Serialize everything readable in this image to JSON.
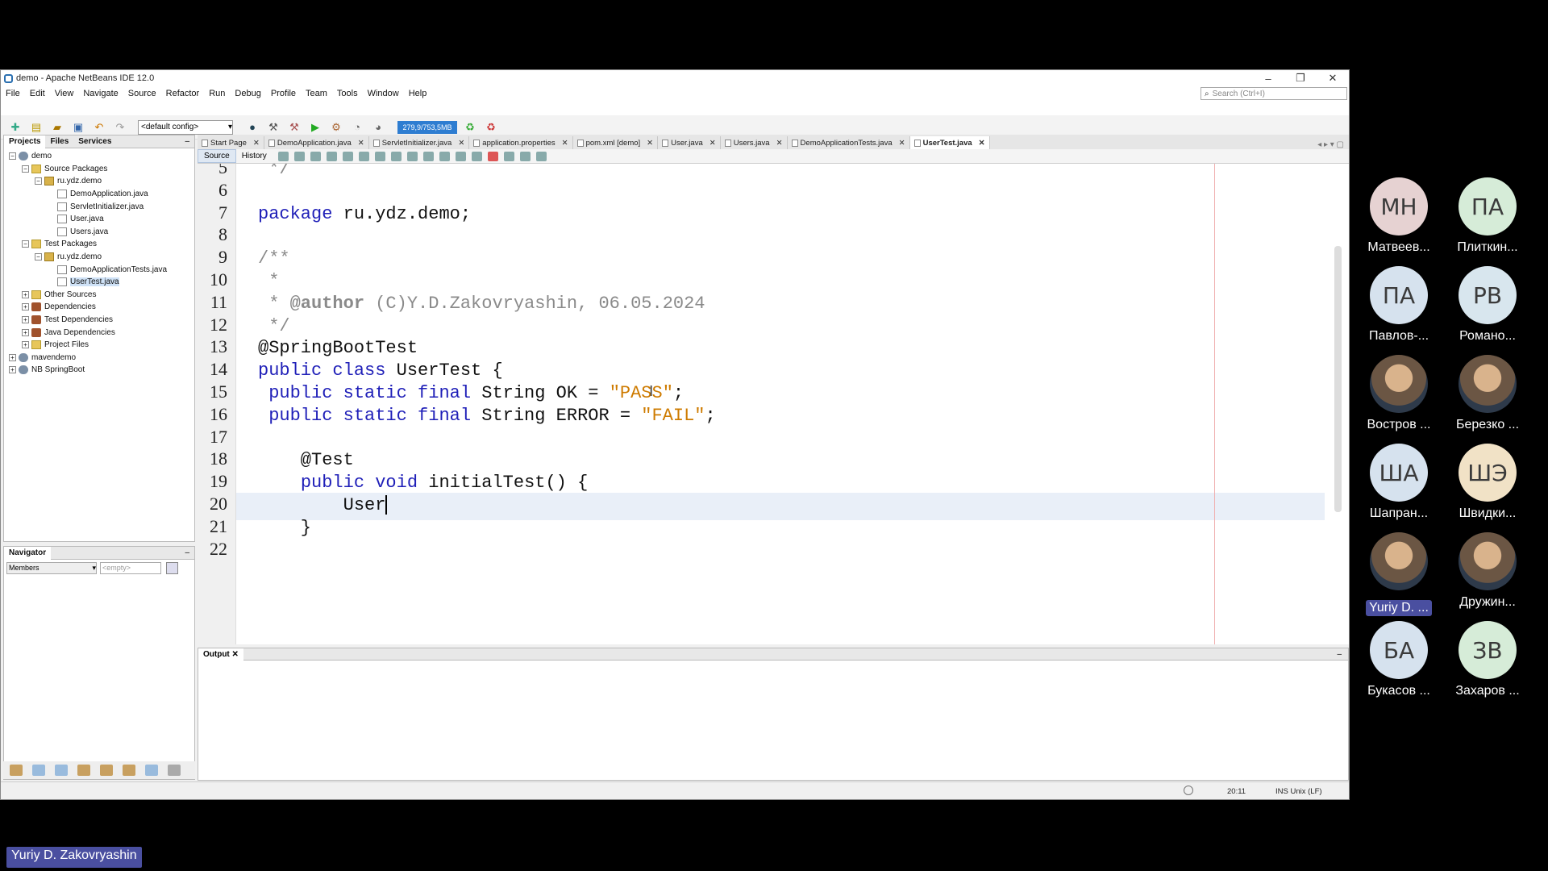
{
  "window": {
    "title": "demo - Apache NetBeans IDE 12.0",
    "controls": [
      "–",
      "❐",
      "✕"
    ]
  },
  "menu": [
    "File",
    "Edit",
    "View",
    "Navigate",
    "Source",
    "Refactor",
    "Run",
    "Debug",
    "Profile",
    "Team",
    "Tools",
    "Window",
    "Help"
  ],
  "search": {
    "placeholder": "Search (Ctrl+I)"
  },
  "toolbar": {
    "config": "<default config>",
    "memory": "279,9/753,5MB"
  },
  "projects_panel": {
    "tabs": [
      "Projects",
      "Files",
      "Services"
    ],
    "tree": [
      {
        "label": "demo",
        "level": 0,
        "icon": "proj",
        "exp": "−"
      },
      {
        "label": "Source Packages",
        "level": 1,
        "icon": "folder",
        "exp": "−"
      },
      {
        "label": "ru.ydz.demo",
        "level": 2,
        "icon": "pkg",
        "exp": "−"
      },
      {
        "label": "DemoApplication.java",
        "level": 3,
        "icon": "file"
      },
      {
        "label": "ServletInitializer.java",
        "level": 3,
        "icon": "file"
      },
      {
        "label": "User.java",
        "level": 3,
        "icon": "file"
      },
      {
        "label": "Users.java",
        "level": 3,
        "icon": "file"
      },
      {
        "label": "Test Packages",
        "level": 1,
        "icon": "folder",
        "exp": "−"
      },
      {
        "label": "ru.ydz.demo",
        "level": 2,
        "icon": "pkg",
        "exp": "−"
      },
      {
        "label": "DemoApplicationTests.java",
        "level": 3,
        "icon": "file"
      },
      {
        "label": "UserTest.java",
        "level": 3,
        "icon": "file",
        "selected": true
      },
      {
        "label": "Other Sources",
        "level": 1,
        "icon": "folder",
        "exp": "+"
      },
      {
        "label": "Dependencies",
        "level": 1,
        "icon": "dep",
        "exp": "+"
      },
      {
        "label": "Test Dependencies",
        "level": 1,
        "icon": "dep",
        "exp": "+"
      },
      {
        "label": "Java Dependencies",
        "level": 1,
        "icon": "dep",
        "exp": "+"
      },
      {
        "label": "Project Files",
        "level": 1,
        "icon": "folder",
        "exp": "+"
      },
      {
        "label": "mavendemo",
        "level": 0,
        "icon": "proj",
        "exp": "+"
      },
      {
        "label": "NB SpringBoot",
        "level": 0,
        "icon": "proj",
        "exp": "+"
      }
    ]
  },
  "navigator": {
    "title": "Navigator",
    "members": "Members",
    "filter": "<empty>"
  },
  "editor": {
    "tabs": [
      "Start Page",
      "DemoApplication.java",
      "ServletInitializer.java",
      "application.properties",
      "pom.xml [demo]",
      "User.java",
      "Users.java",
      "DemoApplicationTests.java",
      "UserTest.java"
    ],
    "active_tab": "UserTest.java",
    "view_tabs": [
      "Source",
      "History"
    ],
    "lines": [
      {
        "n": "5",
        "html": "<span class=\"cmt\"> */</span>"
      },
      {
        "n": "6",
        "html": ""
      },
      {
        "n": "7",
        "html": "<span class=\"kw\">package</span> ru.ydz.demo;"
      },
      {
        "n": "8",
        "html": ""
      },
      {
        "n": "9",
        "html": "<span class=\"cmt\">/**</span>"
      },
      {
        "n": "10",
        "html": "<span class=\"cmt\"> *</span>"
      },
      {
        "n": "11",
        "html": "<span class=\"cmt\"> * </span><span class=\"cmt-b\">@author</span><span class=\"cmt\"> (C)Y.D.Zakovryashin, 06.05.2024</span>"
      },
      {
        "n": "12",
        "html": "<span class=\"cmt\"> */</span>"
      },
      {
        "n": "13",
        "html": "@SpringBootTest"
      },
      {
        "n": "14",
        "html": "<span class=\"kw\">public class</span> UserTest {"
      },
      {
        "n": "15",
        "html": " <span class=\"kw\">public static final</span> String OK = <span class=\"str\">\"PASS\"</span>;"
      },
      {
        "n": "16",
        "html": " <span class=\"kw\">public static final</span> String ERROR = <span class=\"str\">\"FAIL\"</span>;"
      },
      {
        "n": "17",
        "html": ""
      },
      {
        "n": "18",
        "html": "    @Test"
      },
      {
        "n": "19",
        "html": "    <span class=\"kw\">public void</span> initialTest() {"
      },
      {
        "n": "20",
        "html": "        User<span class=\"caret\"></span>"
      },
      {
        "n": "21",
        "html": "    }"
      },
      {
        "n": "22",
        "html": ""
      }
    ]
  },
  "output": {
    "title": "Output"
  },
  "status": {
    "position": "20:11",
    "mode": "INS Unix (LF)"
  },
  "participants": [
    {
      "initials": "МН",
      "name": "Матвеев...",
      "color": "#e6d2d2"
    },
    {
      "initials": "ПА",
      "name": "Плиткин...",
      "color": "#d6ecd8"
    },
    {
      "initials": "ПА",
      "name": "Павлов-...",
      "color": "#d6e2ee"
    },
    {
      "initials": "РВ",
      "name": "Романо...",
      "color": "#d8e6ee"
    },
    {
      "initials": "",
      "name": "Востров ...",
      "photo": true
    },
    {
      "initials": "",
      "name": "Березко ...",
      "photo": true
    },
    {
      "initials": "ША",
      "name": "Шапран...",
      "color": "#d6e2ee"
    },
    {
      "initials": "ШЭ",
      "name": "Швидки...",
      "color": "#f1e2c6"
    },
    {
      "initials": "",
      "name": "Yuriy D. ...",
      "photo": true,
      "highlight": true
    },
    {
      "initials": "",
      "name": "Дружин...",
      "photo": true
    },
    {
      "initials": "БА",
      "name": "Букасов ...",
      "color": "#d6e2ee"
    },
    {
      "initials": "ЗВ",
      "name": "Захаров ...",
      "color": "#d6ecd8"
    }
  ],
  "speaker": "Yuriy D. Zakovryashin"
}
